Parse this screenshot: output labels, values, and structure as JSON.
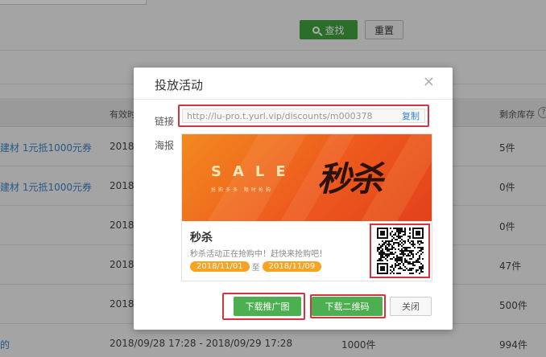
{
  "background": {
    "search_label": "查找",
    "reset_label": "重置",
    "table": {
      "header_valid": "有效时",
      "header_stock": "剩余库存",
      "help_glyph": "?",
      "rows": [
        {
          "name": "建材 1元抵1000元券",
          "time": "2018/",
          "total": "",
          "stock": "5件"
        },
        {
          "name": "建材 1元抵1000元券",
          "time": "2018/",
          "total": "",
          "stock": "0件"
        },
        {
          "name": "",
          "time": "2018/",
          "total": "",
          "stock": "0件"
        },
        {
          "name": "",
          "time": "2018/",
          "total": "",
          "stock": "47件"
        },
        {
          "name": "",
          "time": "2018/",
          "total": "",
          "stock": "500件"
        },
        {
          "name": "的",
          "time": "2018/09/28 17:28 - 2018/09/29 17:28",
          "total": "1000件",
          "stock": "994件"
        }
      ]
    }
  },
  "modal": {
    "title": "投放活动",
    "close_glyph": "×",
    "link_label": "链接",
    "link_value": "http://lu-pro.t.yurl.vip/discounts/m000378",
    "copy_label": "复制",
    "poster_label": "海报",
    "poster": {
      "sale_text": "SALE",
      "sale_subtext": "抢购多多 限时抢购",
      "art_text": "秒杀",
      "title": "秒杀",
      "subtitle": "秒杀活动正在抢购中！赶快来抢购吧！",
      "date_start": "2018/11/01",
      "date_sep": "至",
      "date_end": "2018/11/09"
    },
    "buttons": {
      "download_poster": "下载推广图",
      "download_qr": "下载二维码",
      "close": "关闭"
    }
  },
  "colors": {
    "accent_green": "#4caf50",
    "highlight_red": "#d9323f",
    "link_blue": "#3a83c9",
    "date_pill": "#f5a321"
  }
}
